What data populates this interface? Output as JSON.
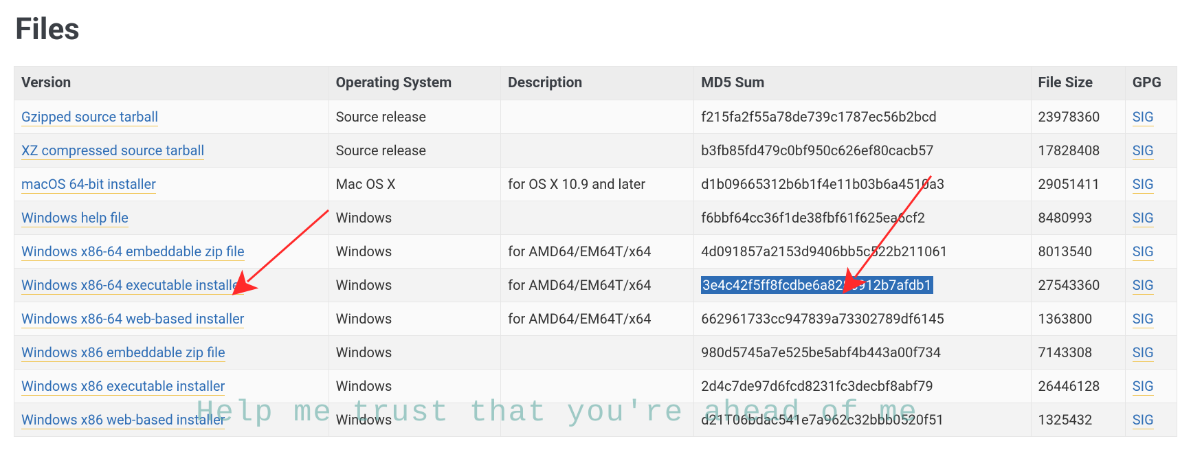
{
  "title": "Files",
  "columns": [
    "Version",
    "Operating System",
    "Description",
    "MD5 Sum",
    "File Size",
    "GPG"
  ],
  "sig_label": "SIG",
  "rows": [
    {
      "version": "Gzipped source tarball",
      "os": "Source release",
      "desc": "",
      "md5": "f215fa2f55a78de739c1787ec56b2bcd",
      "size": "23978360",
      "highlight": false
    },
    {
      "version": "XZ compressed source tarball",
      "os": "Source release",
      "desc": "",
      "md5": "b3fb85fd479c0bf950c626ef80cacb57",
      "size": "17828408",
      "highlight": false
    },
    {
      "version": "macOS 64-bit installer",
      "os": "Mac OS X",
      "desc": "for OS X 10.9 and later",
      "md5": "d1b09665312b6b1f4e11b03b6a4510a3",
      "size": "29051411",
      "highlight": false
    },
    {
      "version": "Windows help file",
      "os": "Windows",
      "desc": "",
      "md5": "f6bbf64cc36f1de38fbf61f625ea6cf2",
      "size": "8480993",
      "highlight": false
    },
    {
      "version": "Windows x86-64 embeddable zip file",
      "os": "Windows",
      "desc": "for AMD64/EM64T/x64",
      "md5": "4d091857a2153d9406bb5c522b211061",
      "size": "8013540",
      "highlight": false
    },
    {
      "version": "Windows x86-64 executable installer",
      "os": "Windows",
      "desc": "for AMD64/EM64T/x64",
      "md5": "3e4c42f5ff8fcdbe6a828c912b7afdb1",
      "size": "27543360",
      "highlight": true
    },
    {
      "version": "Windows x86-64 web-based installer",
      "os": "Windows",
      "desc": "for AMD64/EM64T/x64",
      "md5": "662961733cc947839a73302789df6145",
      "size": "1363800",
      "highlight": false
    },
    {
      "version": "Windows x86 embeddable zip file",
      "os": "Windows",
      "desc": "",
      "md5": "980d5745a7e525be5abf4b443a00f734",
      "size": "7143308",
      "highlight": false
    },
    {
      "version": "Windows x86 executable installer",
      "os": "Windows",
      "desc": "",
      "md5": "2d4c7de97d6fcd8231fc3decbf8abf79",
      "size": "26446128",
      "highlight": false
    },
    {
      "version": "Windows x86 web-based installer",
      "os": "Windows",
      "desc": "",
      "md5": "d21T06bdac541e7a962c32bbb0520f51",
      "size": "1325432",
      "highlight": false
    }
  ],
  "watermark": "Help me trust that you're ahead of me"
}
